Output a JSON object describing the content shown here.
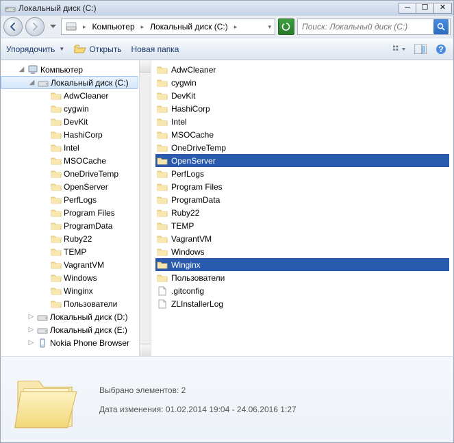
{
  "window": {
    "title": "Локальный диск (C:)"
  },
  "breadcrumb": {
    "segments": [
      "Компьютер",
      "Локальный диск (C:)"
    ]
  },
  "search": {
    "placeholder": "Поиск: Локальный диск (C:)"
  },
  "toolbar": {
    "organize": "Упорядочить",
    "open": "Открыть",
    "new_folder": "Новая папка"
  },
  "tree": {
    "root": "Компьютер",
    "selected": "Локальный диск (C:)",
    "folders": [
      "AdwCleaner",
      "cygwin",
      "DevKit",
      "HashiCorp",
      "Intel",
      "MSOCache",
      "OneDriveTemp",
      "OpenServer",
      "PerfLogs",
      "Program Files",
      "ProgramData",
      "Ruby22",
      "TEMP",
      "VagrantVM",
      "Windows",
      "Winginx",
      "Пользователи"
    ],
    "drives": [
      "Локальный диск (D:)",
      "Локальный диск (E:)"
    ],
    "other": "Nokia Phone Browser"
  },
  "files": {
    "folders": [
      "AdwCleaner",
      "cygwin",
      "DevKit",
      "HashiCorp",
      "Intel",
      "MSOCache",
      "OneDriveTemp",
      "OpenServer",
      "PerfLogs",
      "Program Files",
      "ProgramData",
      "Ruby22",
      "TEMP",
      "VagrantVM",
      "Windows",
      "Winginx",
      "Пользователи"
    ],
    "docs": [
      ".gitconfig",
      "ZLInstallerLog"
    ],
    "selected": [
      "OpenServer",
      "Winginx"
    ]
  },
  "details": {
    "selection": "Выбрано элементов: 2",
    "dates": "Дата изменения: 01.02.2014 19:04 - 24.06.2016 1:27"
  }
}
